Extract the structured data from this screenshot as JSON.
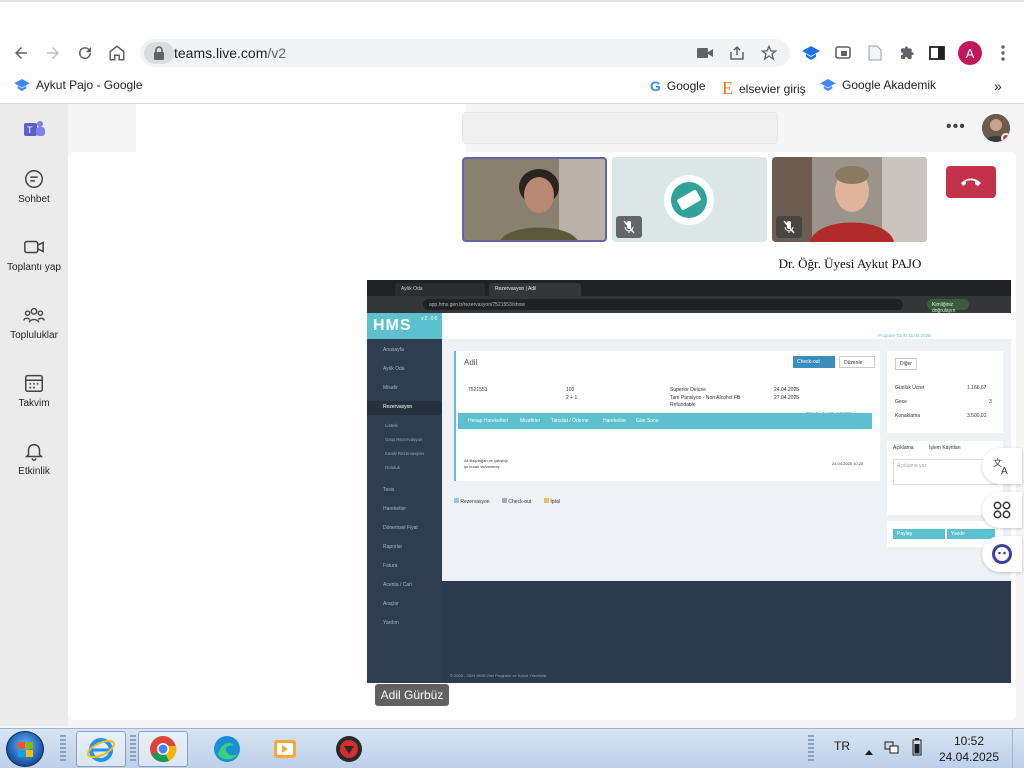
{
  "browser": {
    "url_host": "teams.live.com",
    "url_path": "/v2",
    "profile_initial": "A",
    "bookmarks": [
      {
        "label": "Aykut Pajo - Google"
      },
      {
        "label": "Google"
      },
      {
        "label": "elsevier giriş"
      },
      {
        "label": "Google Akademik"
      }
    ]
  },
  "rail": {
    "items": [
      {
        "label": "Sohbet"
      },
      {
        "label": "Toplantı yap"
      },
      {
        "label": "Topluluklar"
      },
      {
        "label": "Takvim"
      },
      {
        "label": "Etkinlik"
      }
    ]
  },
  "meeting": {
    "tile_name": "Dr. Öğr. Üyesi Aykut PAJO",
    "presenter": "Adil Gürbüz"
  },
  "shared": {
    "tabs": [
      "Aylık Oda",
      "Rezervasyon | Adil"
    ],
    "url": "app.hms.gen.tr/rezervasyon/7521553/show",
    "status_btn": "Kimliğiniz doğrulayın",
    "logo": "HMS",
    "logo_version": "v2.06",
    "program_date": "Program Tarihi:11.04.2025",
    "menu": [
      "Anasayfa",
      "Aylık Oda",
      "Misafir",
      "Rezervasyon",
      "Tesis",
      "Hareketler",
      "Dönemsel Fiyat",
      "Raporlar",
      "Fatura",
      "Acenta / Cari",
      "Araçlar",
      "Yardım"
    ],
    "submenu": [
      "Listele",
      "Grup Rezervasyon",
      "Kanal Rezervasyon",
      "Doluluk"
    ],
    "guest_title": "Adil",
    "checkout_btn": "Check-out",
    "edit_btn": "Düzenle",
    "res_no": "7521553",
    "room_no": "100",
    "pax": "2 + 1",
    "room_type": "Superior Deluxe",
    "board": "Tam Pansiyon - Non Alcohol FB Refundable",
    "checkin_date": "24.04.2025",
    "checkout_date": "27.04.2025",
    "show_all": "TÜM BİLGİLERİ GÖSTER",
    "subtabs": [
      "Hesap Hareketleri",
      "Misafirler",
      "Tahsilat / Ödeme",
      "Hareketler",
      "Gün Sonu"
    ],
    "note_line1": "Ali Başdağan ve çalıştığı",
    "note_line2": "şu kuralı ve/veneniş",
    "note_date": "24.04.2025 10:23",
    "legend": [
      "Rezervasyon",
      "Check-out",
      "İptal"
    ],
    "other_btn": "Diğer",
    "daily_price_label": "Günlük Ücret",
    "daily_price": "1.166,67",
    "nights_label": "Gece",
    "nights": "3",
    "stay_label": "Konaklama",
    "stay_total": "3.500,01",
    "right_tabs": [
      "Açıklama",
      "İşlem Kayıtları"
    ],
    "comment_placeholder": "Açıklama yaz",
    "share_btn": "Paylaş",
    "print_btn": "Yazdır",
    "footer": "© 2009 - 2024 HMS Otel Programı ve Kanal Yöneticisi"
  },
  "taskbar": {
    "lang": "TR",
    "time": "10:52",
    "date": "24.04.2025"
  }
}
